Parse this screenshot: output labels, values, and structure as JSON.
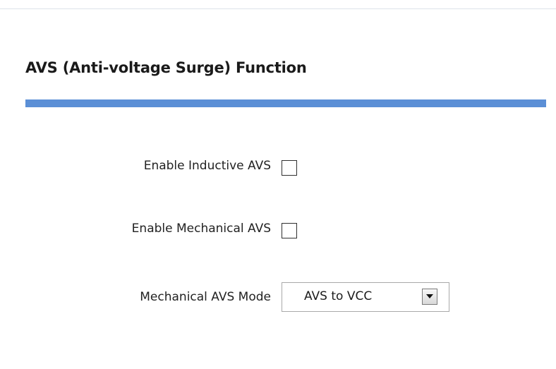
{
  "section": {
    "title": "AVS (Anti-voltage Surge) Function",
    "accent_color": "#5b8fd6"
  },
  "form": {
    "inductive_avs": {
      "label": "Enable Inductive AVS",
      "checked": false
    },
    "mechanical_avs": {
      "label": "Enable Mechanical AVS",
      "checked": false
    },
    "mechanical_avs_mode": {
      "label": "Mechanical AVS Mode",
      "selected": "AVS to VCC",
      "icon": "chevron-down-icon"
    }
  }
}
